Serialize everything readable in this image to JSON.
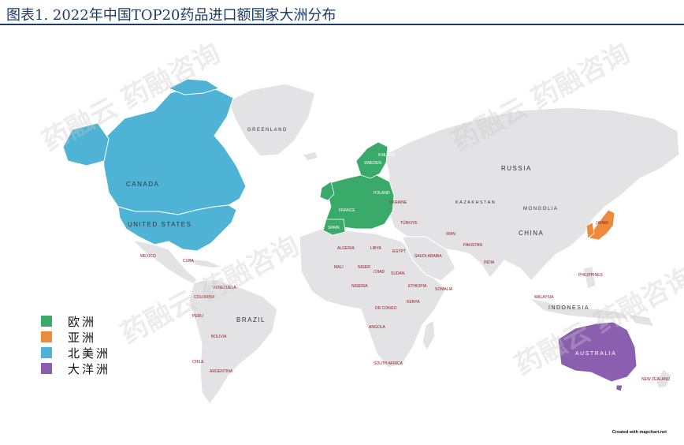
{
  "title": "图表1. 2022年中国TOP20药品进口额国家大洲分布",
  "colors": {
    "europe": "#3aaa6a",
    "asia": "#ee8a3c",
    "north_america": "#4fb3d6",
    "oceania": "#8a5fb0",
    "other": "#e3e3e5"
  },
  "legend": [
    {
      "label": "欧洲",
      "color": "#3aaa6a"
    },
    {
      "label": "亚洲",
      "color": "#ee8a3c"
    },
    {
      "label": "北美洲",
      "color": "#4fb3d6"
    },
    {
      "label": "大洋洲",
      "color": "#8a5fb0"
    }
  ],
  "map_labels": {
    "canada": "CANADA",
    "united_states": "UNITED STATES",
    "greenland": "GREENLAND",
    "russia": "RUSSIA",
    "kazakhstan": "KAZAKHSTAN",
    "mongolia": "MONGOLIA",
    "china": "CHINA",
    "india": "INDIA",
    "iran": "IRAN",
    "turkiye": "TÜRKIYE",
    "egypt": "EGYPT",
    "libya": "LIBYA",
    "algeria": "ALGERIA",
    "mali": "MALI",
    "niger": "NIGER",
    "chad": "CHAD",
    "sudan": "SUDAN",
    "ethiopia": "ETHIOPIA",
    "nigeria": "NIGERIA",
    "dr_congo": "DR CONGO",
    "kenya": "KENYA",
    "angola": "ANGOLA",
    "south_africa": "SOUTH AFRICA",
    "somalia": "SOMALIA",
    "saudi_arabia": "SAUDI ARABIA",
    "brazil": "BRAZIL",
    "peru": "PERU",
    "bolivia": "BOLIVIA",
    "chile": "CHILE",
    "argentina": "ARGENTINA",
    "colombia": "COLOMBIA",
    "venezuela": "VENEZUELA",
    "mexico": "MEXICO",
    "cuba": "CUBA",
    "indonesia": "INDONESIA",
    "philippines": "PHILIPPINES",
    "malaysia": "MALAYSIA",
    "australia": "AUSTRALIA",
    "new_zealand": "NEW ZEALAND",
    "sweden": "SWEDEN",
    "finland": "FINLAND",
    "poland": "POLAND",
    "ukraine": "UKRAINE",
    "spain": "SPAIN",
    "france": "FRANCE",
    "pakistan": "PAKISTAN",
    "japan": "JAPAN"
  },
  "credit": "Created with mapchart.net",
  "watermark": "药融云 药融咨询"
}
